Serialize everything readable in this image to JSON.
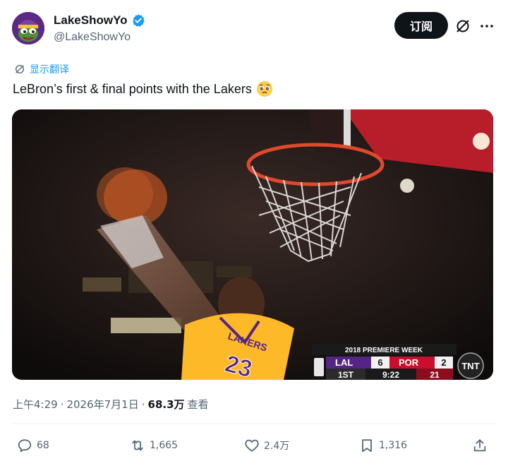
{
  "author": {
    "display_name": "LakeShowYo",
    "handle": "@LakeShowYo"
  },
  "header": {
    "subscribe_label": "订阅"
  },
  "translate": {
    "label": "显示翻译"
  },
  "tweet": {
    "text": "LeBron’s first & final points with the Lakers",
    "emoji": "pleading-face"
  },
  "media": {
    "scoreboard": {
      "title": "2018 PREMIERE WEEK",
      "team1": "LAL",
      "score1": "6",
      "team2": "POR",
      "score2": "2",
      "quarter": "1ST",
      "clock": "9:22",
      "shot_clock": "21",
      "network": "TNT"
    },
    "jersey_number": "23",
    "jersey_text": "LAKERS"
  },
  "meta": {
    "time": "上午4:29",
    "date": "2026年7月1日",
    "separator": "·",
    "views": "68.3万",
    "views_label": "查看"
  },
  "actions": {
    "replies": "68",
    "reposts": "1,665",
    "likes": "2.4万",
    "bookmarks": "1,316"
  },
  "colors": {
    "accent": "#1d9bf0",
    "lakers_purple": "#552583",
    "lakers_gold": "#fdb927",
    "blazers_red": "#c8102e"
  }
}
